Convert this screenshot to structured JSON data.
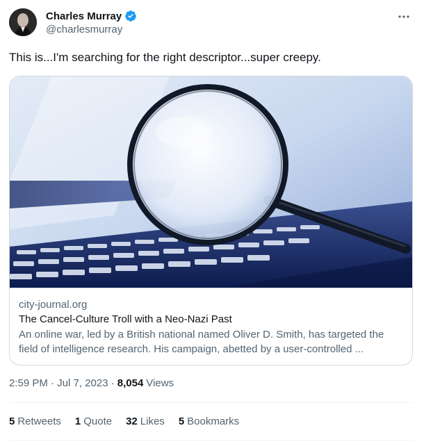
{
  "author": {
    "display_name": "Charles Murray",
    "handle": "@charlesmurray",
    "verified_color": "#1d9bf0"
  },
  "tweet": {
    "text": "This is...I'm searching for the right descriptor...super creepy."
  },
  "card": {
    "domain": "city-journal.org",
    "title": "The Cancel-Culture Troll with a Neo-Nazi Past",
    "description": "An online war, led by a British national named Oliver D. Smith, has targeted the field of intelligence research. His campaign, abetted by a user-controlled ..."
  },
  "meta": {
    "timestamp": "2:59 PM · Jul 7, 2023 ·",
    "views_count": "8,054",
    "views_label": "Views"
  },
  "stats": [
    {
      "count": "5",
      "label": "Retweets"
    },
    {
      "count": "1",
      "label": "Quote"
    },
    {
      "count": "32",
      "label": "Likes"
    },
    {
      "count": "5",
      "label": "Bookmarks"
    }
  ],
  "icons": {
    "more": "more-horizontal-icon",
    "verified": "verified-badge-icon"
  }
}
